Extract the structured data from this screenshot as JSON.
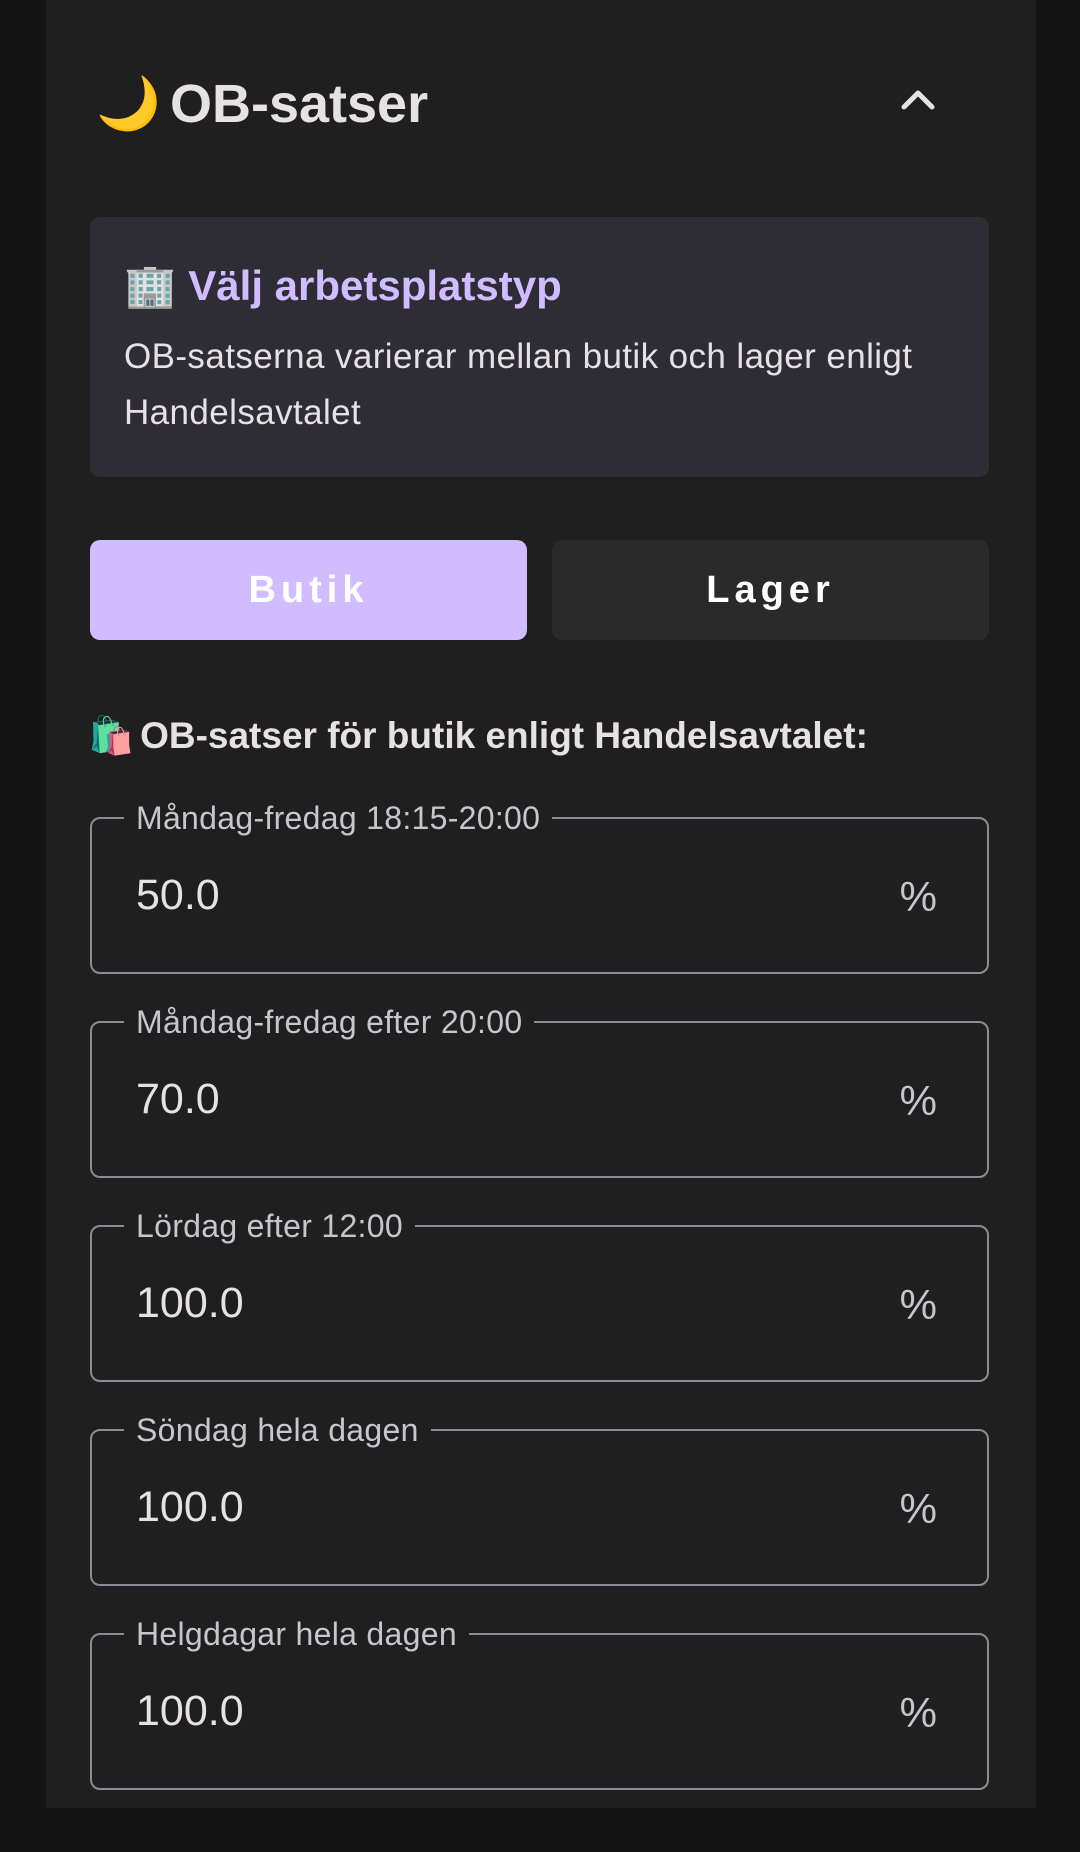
{
  "header": {
    "icon": "🌙",
    "title": "OB-satser",
    "collapse_icon": "chevron-up-icon"
  },
  "info_box": {
    "icon": "🏢",
    "title": "Välj arbetsplatstyp",
    "description": "OB-satserna varierar mellan butik och lager enligt Handelsavtalet"
  },
  "workplace_toggle": {
    "selected": "Butik",
    "options": [
      "Butik",
      "Lager"
    ]
  },
  "section": {
    "icon": "🛍️",
    "heading": "OB-satser för butik enligt Handelsavtalet:"
  },
  "fields": [
    {
      "label": "Måndag-fredag 18:15-20:00",
      "value": "50.0",
      "suffix": "%"
    },
    {
      "label": "Måndag-fredag efter 20:00",
      "value": "70.0",
      "suffix": "%"
    },
    {
      "label": "Lördag efter 12:00",
      "value": "100.0",
      "suffix": "%"
    },
    {
      "label": "Söndag hela dagen",
      "value": "100.0",
      "suffix": "%"
    },
    {
      "label": "Helgdagar hela dagen",
      "value": "100.0",
      "suffix": "%"
    }
  ],
  "colors": {
    "accent": "#d0bcff",
    "card_bg": "#1f1f1f",
    "info_bg": "#2e2d35",
    "outline": "#8d8a93"
  }
}
